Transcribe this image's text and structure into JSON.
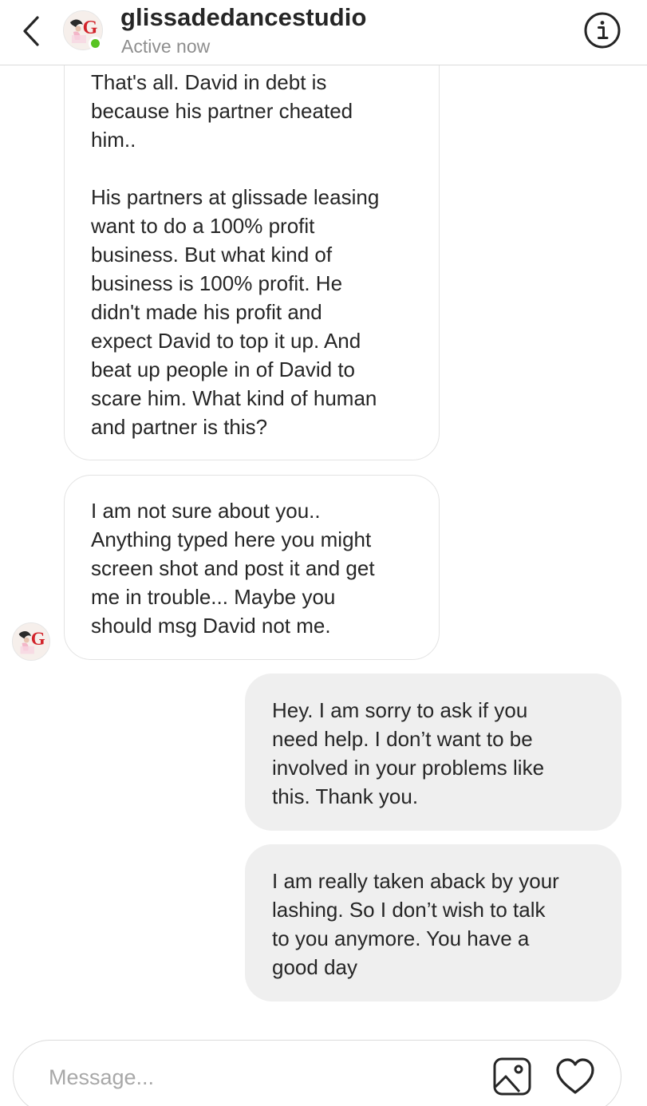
{
  "header": {
    "username": "glissadedancestudio",
    "status": "Active now",
    "back_icon": "chevron-left-icon",
    "info_icon": "info-circle-icon",
    "online_color": "#58c322"
  },
  "messages": [
    {
      "direction": "incoming",
      "text": "That's all. David in debt is\nbecause his partner cheated\nhim..\n\nHis partners at glissade leasing\nwant to do a 100% profit\nbusiness. But what kind of\nbusiness is 100% profit. He\ndidn't made his profit and\nexpect David to top it up. And\nbeat up people in of David to\nscare him. What kind of human\nand partner is this?"
    },
    {
      "direction": "incoming",
      "text": "I am not sure about you..\nAnything typed here you might\nscreen shot and post it and get\nme in trouble... Maybe you\nshould msg David not me."
    },
    {
      "direction": "outgoing",
      "text": "Hey. I am sorry to ask if you\nneed help. I don’t want to be\ninvolved in your problems like\nthis. Thank you."
    },
    {
      "direction": "outgoing",
      "text": "I am really taken aback by your\nlashing. So I don’t wish to talk\nto you anymore. You have a\ngood day"
    }
  ],
  "composer": {
    "placeholder": "Message...",
    "value": "",
    "gallery_icon": "image-icon",
    "like_icon": "heart-icon"
  },
  "colors": {
    "incoming_bubble_bg": "#ffffff",
    "incoming_bubble_border": "#e3e3e3",
    "outgoing_bubble_bg": "#efefef",
    "text": "#262626",
    "secondary_text": "#8e8e8e"
  }
}
